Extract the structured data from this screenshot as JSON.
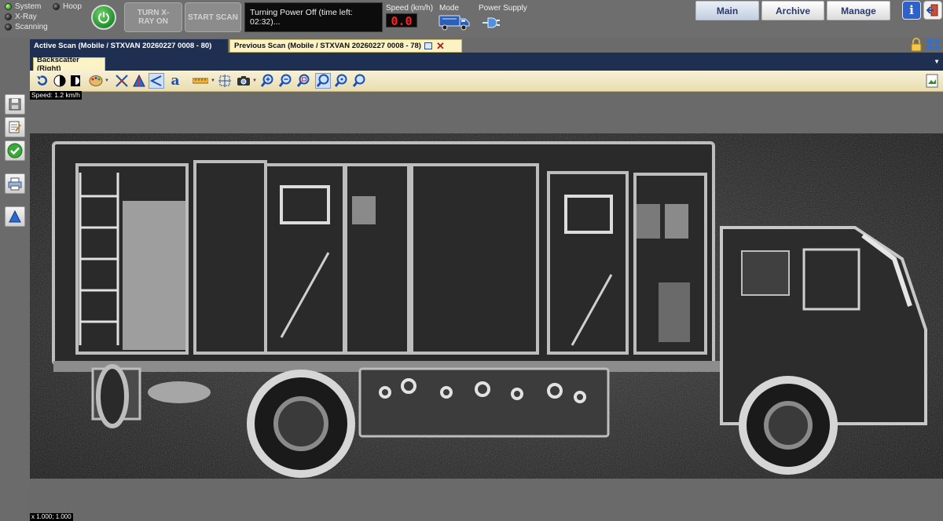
{
  "indicators": {
    "system": "System",
    "hoop": "Hoop",
    "xray": "X-Ray",
    "scanning": "Scanning"
  },
  "controls": {
    "turn_xray_on": "TURN X-RAY ON",
    "start_scan": "START SCAN"
  },
  "status": {
    "message": "Turning Power Off (time left: 02:32)..."
  },
  "speed": {
    "label": "Speed (km/h)",
    "value": "0.0"
  },
  "mode": {
    "label": "Mode"
  },
  "power_supply": {
    "label": "Power Supply"
  },
  "nav": {
    "main": "Main",
    "archive": "Archive",
    "manage": "Manage"
  },
  "tabs": {
    "active_scan": "Active Scan (Mobile / STXVAN 20260227 0008 - 80)",
    "previous_scan": "Previous Scan (Mobile / STXVAN 20260227 0008 - 78)"
  },
  "subtab": {
    "label": "Backscatter (Right)"
  },
  "overlay": {
    "speed": "Speed: 1.2 km/h",
    "zoom": "x 1.000; 1.000"
  },
  "icons": {
    "toolbar": [
      "undo-icon",
      "contrast-icon",
      "invert-icon",
      "palette-icon",
      "edge-filter-icon",
      "sharpen-icon",
      "measure-angle-icon",
      "text-annotation-icon",
      "ruler-icon",
      "crosshair-icon",
      "camera-icon",
      "zoom-in-icon",
      "zoom-out-icon",
      "zoom-region-icon",
      "zoom-fit-icon",
      "zoom-actual-icon",
      "zoom-100-icon"
    ],
    "sidebar": [
      "save-icon",
      "edit-report-icon",
      "approve-icon",
      "print-icon",
      "upload-icon"
    ]
  },
  "colors": {
    "tab_active_bg": "#1f2f52",
    "tab_inactive_bg": "#fbf3c5",
    "speed_digits": "#ff2020",
    "led_on": "#29a11e"
  }
}
